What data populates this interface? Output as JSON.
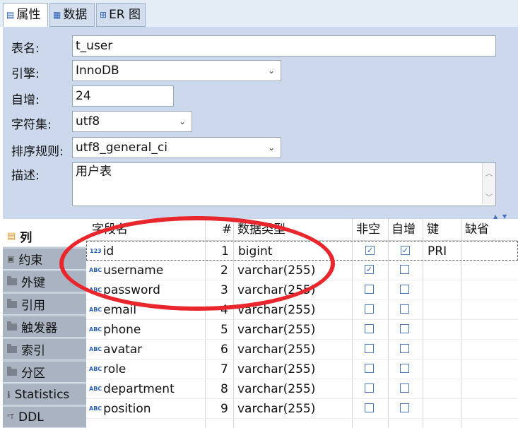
{
  "tabs": [
    {
      "label": "属性",
      "icon": "properties-icon"
    },
    {
      "label": "数据",
      "icon": "data-grid-icon"
    },
    {
      "label": "ER 图",
      "icon": "er-diagram-icon"
    }
  ],
  "form": {
    "table_name_label": "表名:",
    "table_name_value": "t_user",
    "engine_label": "引擎:",
    "engine_value": "InnoDB",
    "auto_inc_label": "自增:",
    "auto_inc_value": "24",
    "charset_label": "字符集:",
    "charset_value": "utf8",
    "collation_label": "排序规则:",
    "collation_value": "utf8_general_ci",
    "desc_label": "描述:",
    "desc_value": "用户表"
  },
  "sidebar": {
    "items": [
      {
        "label": "列",
        "icon": "columns-icon"
      },
      {
        "label": "约束",
        "icon": "constraint-icon"
      },
      {
        "label": "外键",
        "icon": "folder-icon"
      },
      {
        "label": "引用",
        "icon": "folder-icon"
      },
      {
        "label": "触发器",
        "icon": "folder-icon"
      },
      {
        "label": "索引",
        "icon": "folder-icon"
      },
      {
        "label": "分区",
        "icon": "folder-icon"
      },
      {
        "label": "Statistics",
        "icon": "statistics-icon"
      },
      {
        "label": "DDL",
        "icon": "ddl-icon"
      }
    ]
  },
  "columns_table": {
    "headers": {
      "name": "字段名",
      "num": "#",
      "type": "数据类型",
      "not_null": "非空",
      "auto_inc": "自增",
      "key": "键",
      "default": "缺省"
    },
    "rows": [
      {
        "icon": "123",
        "name": "id",
        "num": "1",
        "type": "bigint",
        "not_null": true,
        "auto_inc": true,
        "key": "PRI"
      },
      {
        "icon": "ABC",
        "name": "username",
        "num": "2",
        "type": "varchar(255)",
        "not_null": true,
        "auto_inc": false,
        "key": ""
      },
      {
        "icon": "ABC",
        "name": "password",
        "num": "3",
        "type": "varchar(255)",
        "not_null": false,
        "auto_inc": false,
        "key": ""
      },
      {
        "icon": "ABC",
        "name": "email",
        "num": "4",
        "type": "varchar(255)",
        "not_null": false,
        "auto_inc": false,
        "key": ""
      },
      {
        "icon": "ABC",
        "name": "phone",
        "num": "5",
        "type": "varchar(255)",
        "not_null": false,
        "auto_inc": false,
        "key": ""
      },
      {
        "icon": "ABC",
        "name": "avatar",
        "num": "6",
        "type": "varchar(255)",
        "not_null": false,
        "auto_inc": false,
        "key": ""
      },
      {
        "icon": "ABC",
        "name": "role",
        "num": "7",
        "type": "varchar(255)",
        "not_null": false,
        "auto_inc": false,
        "key": ""
      },
      {
        "icon": "ABC",
        "name": "department",
        "num": "8",
        "type": "varchar(255)",
        "not_null": false,
        "auto_inc": false,
        "key": ""
      },
      {
        "icon": "ABC",
        "name": "position",
        "num": "9",
        "type": "varchar(255)",
        "not_null": false,
        "auto_inc": false,
        "key": ""
      }
    ]
  },
  "colors": {
    "annotation": "#e8262b",
    "accent": "#2b61b5",
    "panel": "#ccd9ec"
  }
}
